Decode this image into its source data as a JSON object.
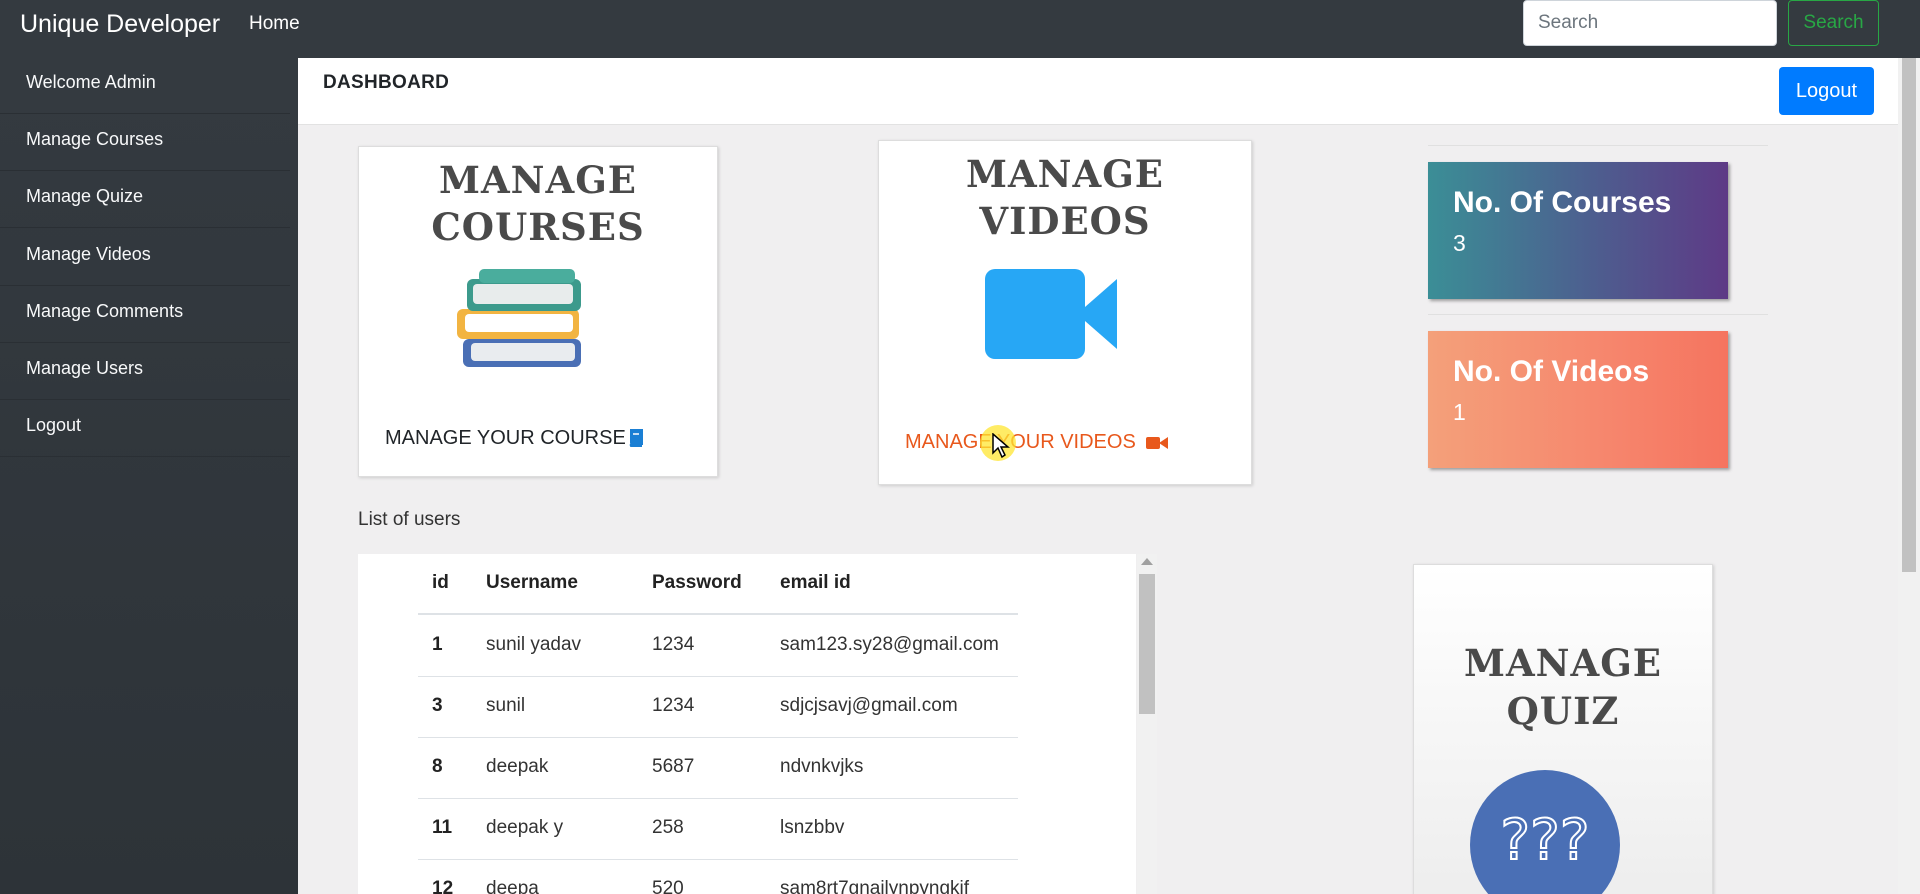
{
  "navbar": {
    "brand": "Unique Developer",
    "home": "Home",
    "search_placeholder": "Search",
    "search_button": "Search"
  },
  "sidebar": {
    "items": [
      {
        "label": "Welcome Admin"
      },
      {
        "label": "Manage Courses"
      },
      {
        "label": "Manage Quize"
      },
      {
        "label": "Manage Videos"
      },
      {
        "label": "Manage Comments"
      },
      {
        "label": "Manage Users"
      },
      {
        "label": "Logout"
      }
    ]
  },
  "header": {
    "title": "DASHBOARD",
    "logout": "Logout"
  },
  "cards": {
    "courses": {
      "title_line1": "MANAGE",
      "title_line2": "COURSES",
      "link": "MANAGE YOUR COURSE",
      "link_color": "#1a7fd4",
      "icon": "book-icon"
    },
    "videos": {
      "title_line1": "MANAGE",
      "title_line2": "VIDEOS",
      "link": "MANAGE YOUR VIDEOS",
      "link_color": "#e8581c",
      "icon": "video-camera-icon"
    },
    "quiz": {
      "title_line1": "MANAGE",
      "title_line2": "QUIZ",
      "badge": "???"
    }
  },
  "stats": {
    "courses": {
      "label": "No. Of Courses",
      "value": "3"
    },
    "videos": {
      "label": "No. Of Videos",
      "value": "1"
    }
  },
  "users": {
    "title": "List of users",
    "columns": [
      "id",
      "Username",
      "Password",
      "email id"
    ],
    "rows": [
      [
        "1",
        "sunil yadav",
        "1234",
        "sam123.sy28@gmail.com"
      ],
      [
        "3",
        "sunil",
        "1234",
        "sdjcjsavj@gmail.com"
      ],
      [
        "8",
        "deepak",
        "5687",
        "ndvnkvjks"
      ],
      [
        "11",
        "deepak y",
        "258",
        "lsnzbbv"
      ],
      [
        "12",
        "deepa",
        "520",
        "sam8rt7gnailynpyngkif"
      ]
    ]
  },
  "colors": {
    "navbar": "#343a40",
    "primary": "#007bff",
    "success": "#28a745"
  }
}
